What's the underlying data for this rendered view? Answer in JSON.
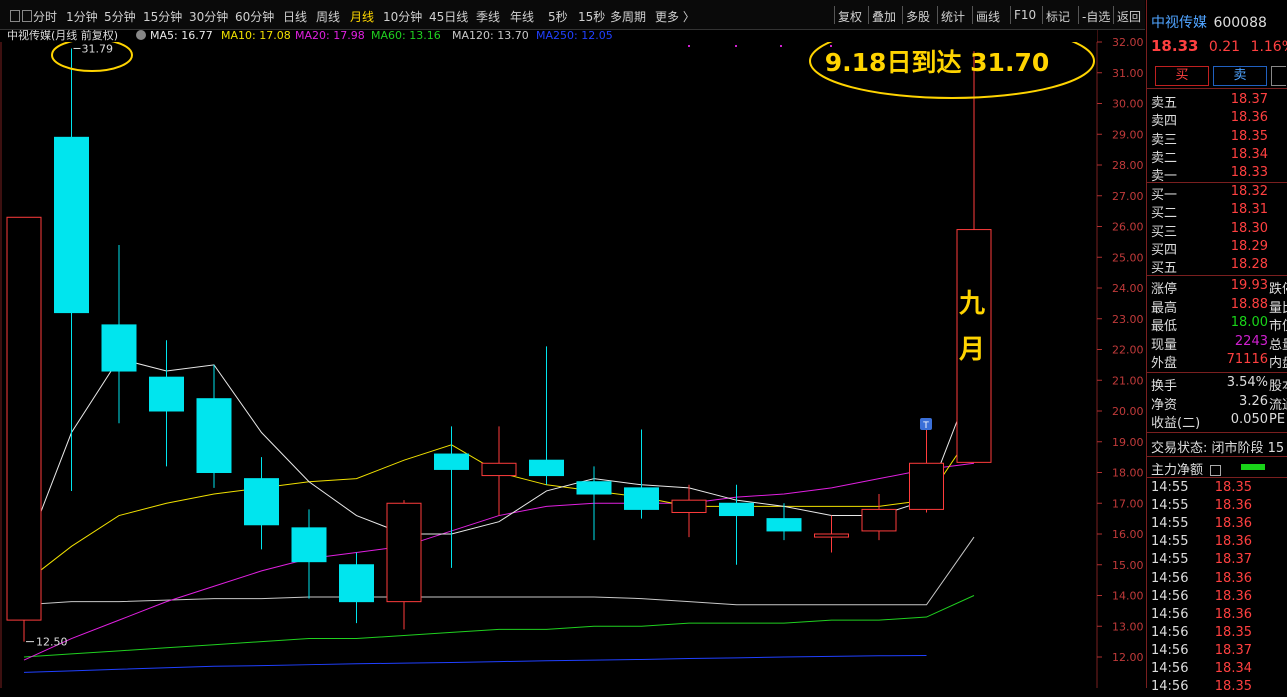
{
  "toolbar": {
    "periods": [
      "分时",
      "1分钟",
      "5分钟",
      "15分钟",
      "30分钟",
      "60分钟",
      "日线",
      "周线",
      "月线",
      "10分钟",
      "45日线",
      "季线",
      "年线",
      "5秒",
      "15秒",
      "多周期",
      "更多 〉"
    ],
    "active_period": "月线",
    "tools": [
      "复权",
      "叠加",
      "多股",
      "统计",
      "画线",
      "F10",
      "标记",
      "-自选",
      "返回"
    ]
  },
  "legend": {
    "title": "中视传媒(月线 前复权)",
    "items": [
      {
        "label": "MA5: 16.77",
        "color": "#e8e8e8"
      },
      {
        "label": "MA10: 17.08",
        "color": "#f0e000"
      },
      {
        "label": "MA20: 17.98",
        "color": "#e020e0"
      },
      {
        "label": "MA60: 13.16",
        "color": "#20d020"
      },
      {
        "label": "MA120: 13.70",
        "color": "#c8c8c8"
      },
      {
        "label": "MA250: 12.05",
        "color": "#2040ff"
      }
    ]
  },
  "annotations": {
    "main_text": "9.18日到达 31.70",
    "vertical_text": [
      "九",
      "月"
    ],
    "high_label": "31.79",
    "low_label": "12.50",
    "marker": "T"
  },
  "colors": {
    "up": "#ff3c3c",
    "down": "#00e5ee",
    "annotation": "#ffd400",
    "grid": "#3a0d0d"
  },
  "chart_data": {
    "type": "candlestick",
    "ylim": [
      11.5,
      32.3
    ],
    "yticks": [
      "12.00",
      "13.00",
      "14.00",
      "15.00",
      "16.00",
      "17.00",
      "18.00",
      "19.00",
      "20.00",
      "21.00",
      "22.00",
      "23.00",
      "24.00",
      "25.00",
      "26.00",
      "27.00",
      "28.00",
      "29.00",
      "30.00",
      "31.00",
      "32.00"
    ],
    "candles": [
      {
        "o": 13.2,
        "c": 26.3,
        "h": 26.3,
        "l": 12.5
      },
      {
        "o": 28.9,
        "c": 23.2,
        "h": 31.79,
        "l": 17.4
      },
      {
        "o": 22.8,
        "c": 21.3,
        "h": 25.4,
        "l": 19.6
      },
      {
        "o": 21.1,
        "c": 20.0,
        "h": 22.3,
        "l": 18.2
      },
      {
        "o": 20.4,
        "c": 18.0,
        "h": 21.5,
        "l": 17.5
      },
      {
        "o": 17.8,
        "c": 16.3,
        "h": 18.5,
        "l": 15.5
      },
      {
        "o": 16.2,
        "c": 15.1,
        "h": 16.8,
        "l": 13.9
      },
      {
        "o": 15.0,
        "c": 13.8,
        "h": 15.4,
        "l": 13.1
      },
      {
        "o": 13.8,
        "c": 17.0,
        "h": 17.1,
        "l": 12.9
      },
      {
        "o": 18.6,
        "c": 18.1,
        "h": 19.5,
        "l": 14.9
      },
      {
        "o": 17.9,
        "c": 18.3,
        "h": 19.5,
        "l": 16.6
      },
      {
        "o": 18.4,
        "c": 17.9,
        "h": 22.1,
        "l": 17.6
      },
      {
        "o": 17.7,
        "c": 17.3,
        "h": 18.2,
        "l": 15.8
      },
      {
        "o": 17.5,
        "c": 16.8,
        "h": 19.4,
        "l": 16.5
      },
      {
        "o": 16.7,
        "c": 17.1,
        "h": 17.6,
        "l": 15.9
      },
      {
        "o": 17.0,
        "c": 16.6,
        "h": 17.6,
        "l": 15.0
      },
      {
        "o": 16.5,
        "c": 16.1,
        "h": 17.0,
        "l": 15.8
      },
      {
        "o": 15.9,
        "c": 16.0,
        "h": 16.6,
        "l": 15.4
      },
      {
        "o": 16.1,
        "c": 16.8,
        "h": 17.3,
        "l": 15.8
      },
      {
        "o": 16.8,
        "c": 18.3,
        "h": 19.4,
        "l": 16.7
      },
      {
        "o": 18.33,
        "c": 25.9,
        "h": 31.7,
        "l": 18.33
      }
    ],
    "ma5": [
      15.3,
      19.3,
      21.7,
      21.3,
      21.5,
      19.3,
      17.7,
      16.6,
      16.0,
      16.0,
      16.4,
      17.4,
      17.8,
      17.6,
      17.5,
      17.1,
      16.9,
      16.6,
      16.6,
      17.1,
      21.1
    ],
    "ma10": [
      14.4,
      15.6,
      16.6,
      17.0,
      17.3,
      17.5,
      17.7,
      17.8,
      18.4,
      18.9,
      18.0,
      17.6,
      17.4,
      17.2,
      16.9,
      16.9,
      16.9,
      16.9,
      16.9,
      17.1,
      19.4
    ],
    "ma20": [
      11.9,
      12.6,
      13.2,
      13.8,
      14.3,
      14.8,
      15.2,
      15.4,
      15.6,
      16.1,
      16.6,
      16.9,
      17.0,
      17.0,
      17.0,
      17.2,
      17.3,
      17.5,
      17.8,
      18.1,
      18.3
    ],
    "ma60": [
      12.0,
      12.1,
      12.2,
      12.3,
      12.4,
      12.5,
      12.6,
      12.6,
      12.7,
      12.8,
      12.9,
      12.9,
      13.0,
      13.0,
      13.1,
      13.1,
      13.1,
      13.2,
      13.2,
      13.3,
      14.0
    ],
    "ma120": [
      13.7,
      13.8,
      13.8,
      13.85,
      13.9,
      13.9,
      13.95,
      13.95,
      13.95,
      13.95,
      13.95,
      13.95,
      13.95,
      13.9,
      13.8,
      13.7,
      13.7,
      13.7,
      13.7,
      13.7,
      15.9
    ],
    "ma250": [
      11.5,
      11.55,
      11.6,
      11.65,
      11.7,
      11.72,
      11.75,
      11.78,
      11.8,
      11.82,
      11.85,
      11.88,
      11.9,
      11.92,
      11.95,
      11.97,
      12.0,
      12.02,
      12.04,
      12.05,
      null
    ]
  },
  "panel": {
    "name": "中视传媒",
    "code": "600088",
    "price": "18.33",
    "change": "0.21",
    "pct": "1.16%",
    "buy_label": "买",
    "sell_label": "卖",
    "asks": [
      {
        "label": "卖五",
        "price": "18.37"
      },
      {
        "label": "卖四",
        "price": "18.36"
      },
      {
        "label": "卖三",
        "price": "18.35"
      },
      {
        "label": "卖二",
        "price": "18.34"
      },
      {
        "label": "卖一",
        "price": "18.33"
      }
    ],
    "bids": [
      {
        "label": "买一",
        "price": "18.32"
      },
      {
        "label": "买二",
        "price": "18.31"
      },
      {
        "label": "买三",
        "price": "18.30"
      },
      {
        "label": "买四",
        "price": "18.29"
      },
      {
        "label": "买五",
        "price": "18.28"
      }
    ],
    "stats": [
      {
        "label": "涨停",
        "value": "19.93",
        "extra": "跌停"
      },
      {
        "label": "最高",
        "value": "18.88",
        "extra": "量比"
      },
      {
        "label": "最低",
        "value": "18.00",
        "extra": "市值"
      },
      {
        "label": "现量",
        "value": "2243",
        "extra": "总量"
      },
      {
        "label": "外盘",
        "value": "71116",
        "extra": "内盘"
      }
    ],
    "stats2": [
      {
        "label": "换手",
        "value": "3.54%",
        "extra": "股本"
      },
      {
        "label": "净资",
        "value": "3.26",
        "extra": "流通"
      },
      {
        "label": "收益(二)",
        "value": "0.050",
        "extra": "PE"
      }
    ],
    "trade_status": "交易状态: 闭市阶段 15",
    "main_flow": "主力净额",
    "ticks": [
      {
        "t": "14:55",
        "p": "18.35"
      },
      {
        "t": "14:55",
        "p": "18.36"
      },
      {
        "t": "14:55",
        "p": "18.36"
      },
      {
        "t": "14:55",
        "p": "18.36"
      },
      {
        "t": "14:55",
        "p": "18.37"
      },
      {
        "t": "14:56",
        "p": "18.36"
      },
      {
        "t": "14:56",
        "p": "18.36"
      },
      {
        "t": "14:56",
        "p": "18.36"
      },
      {
        "t": "14:56",
        "p": "18.35"
      },
      {
        "t": "14:56",
        "p": "18.37"
      },
      {
        "t": "14:56",
        "p": "18.34"
      },
      {
        "t": "14:56",
        "p": "18.35"
      }
    ]
  }
}
